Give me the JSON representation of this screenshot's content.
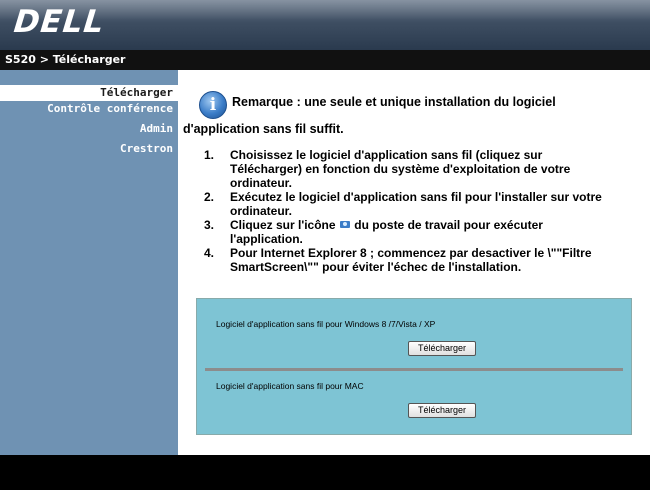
{
  "header": {
    "logo_text": "DELL"
  },
  "breadcrumb": "S520 > Télécharger",
  "sidebar": {
    "items": [
      {
        "label": "Télécharger",
        "active": true
      },
      {
        "label": "Contrôle conférence",
        "active": false
      },
      {
        "label": "Admin",
        "active": false
      },
      {
        "label": "Crestron",
        "active": false
      }
    ]
  },
  "main": {
    "note_icon": "info-icon",
    "note_line1": "Remarque : une seule et unique installation du logiciel",
    "note_line2": "d'application sans fil suffit.",
    "steps": [
      {
        "num": "1.",
        "text": "Choisissez le logiciel d'application sans fil (cliquez sur Télécharger) en fonction du système d'exploitation de votre ordinateur."
      },
      {
        "num": "2.",
        "text": "Exécutez le logiciel d'application sans fil pour l'installer sur votre ordinateur."
      },
      {
        "num": "3.",
        "text_before": "Cliquez sur l'icône",
        "icon": "camera-icon",
        "text_after": "du poste de travail pour exécuter l'application."
      },
      {
        "num": "4.",
        "text": "Pour Internet Explorer 8 ; commencez par desactiver le \\\"\"Filtre SmartScreen\\\"\" pour éviter l'échec de l'installation."
      }
    ],
    "downloads": [
      {
        "label": "Logiciel d'application sans fil pour Windows 8 /7/Vista / XP",
        "button": "Télécharger"
      },
      {
        "label": "Logiciel d'application sans fil pour MAC",
        "button": "Télécharger"
      }
    ]
  },
  "colors": {
    "sidebar": "#6f92b3",
    "download_panel": "#7ec4d4",
    "breadcrumb_bar": "#111111"
  }
}
